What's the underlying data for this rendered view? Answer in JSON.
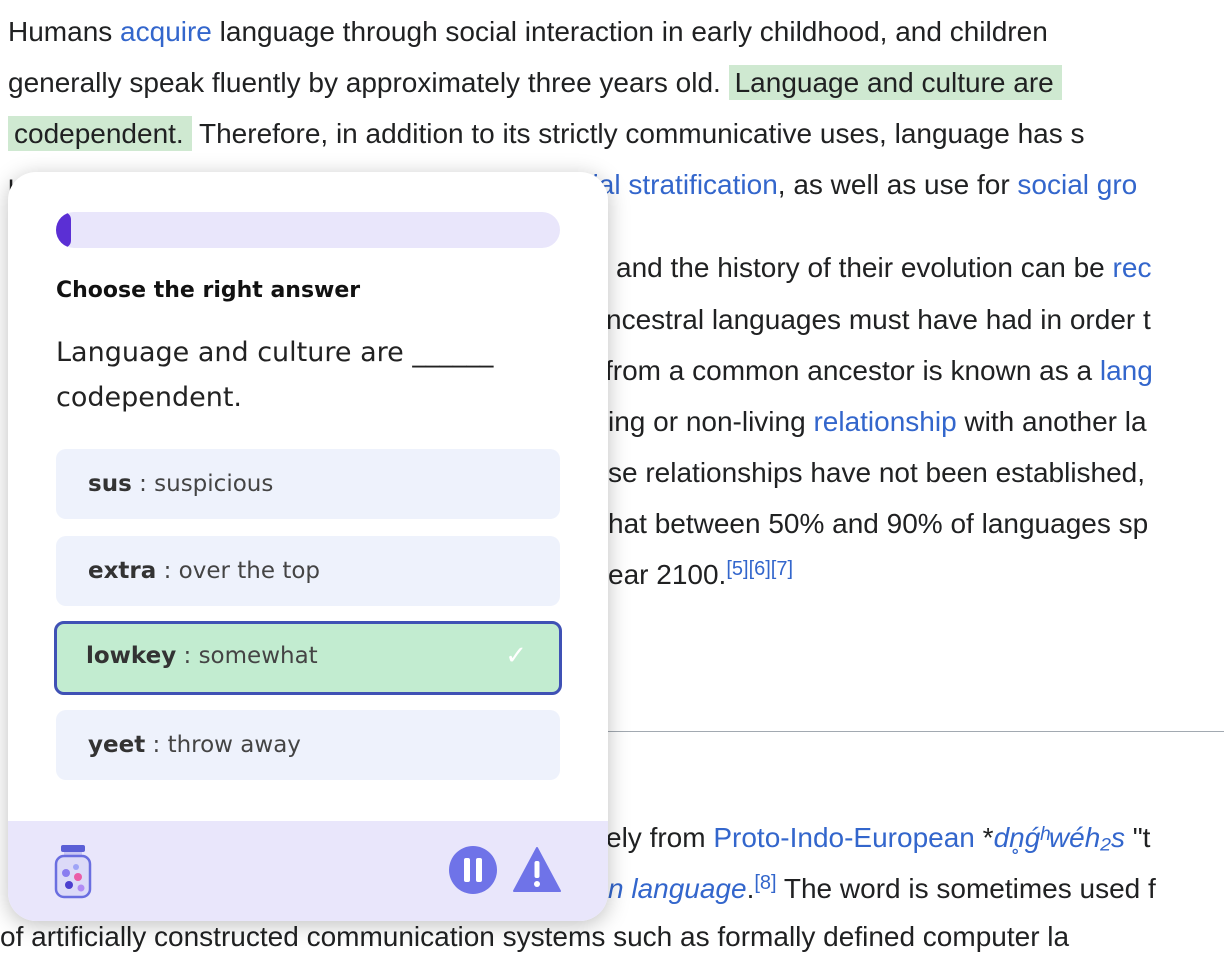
{
  "article": {
    "l1": {
      "a": "Humans ",
      "link": "acquire",
      "b": " language through social interaction in early childhood, and children"
    },
    "l2": {
      "a": "generally speak fluently by approximately three years old. ",
      "hl": "Language and culture are"
    },
    "l3": {
      "hl": "codependent.",
      "b": " Therefore, in addition to its strictly communicative uses, language has s"
    },
    "l4": {
      "a": "u",
      "link1": "cial stratification",
      "b": ", as well as use for ",
      "link2": "social gro"
    },
    "l5": {
      "a": "and the history of their evolution can be ",
      "link": "rec"
    },
    "l6": {
      "a": "ncestral languages must have had in order t"
    },
    "l7": {
      "a": "from a common ancestor is known as a ",
      "link": "lang"
    },
    "l8": {
      "a": "ing or non-living ",
      "link": "relationship",
      "b": " with another la"
    },
    "l9": {
      "a": "se relationships have not been established,"
    },
    "l10": {
      "a": "hat between 50% and 90% of languages sp"
    },
    "l11": {
      "a": "ear 2100.",
      "sup": "[5][6][7]"
    },
    "l12": {
      "a": "ely from ",
      "link": "Proto-Indo-European",
      "b": " *",
      "ital": "dn̥ǵʰwéh₂s",
      "c": " \"t"
    },
    "l13": {
      "link": "n language",
      "b": ".",
      "sup": "[8]",
      "c": " The word is sometimes used f"
    },
    "l14": {
      "a": "of artificially constructed communication systems such as formally defined computer la"
    }
  },
  "quiz": {
    "progress": 0.03,
    "instruction": "Choose the right answer",
    "question": "Language and culture are ______ codependent.",
    "options": [
      {
        "term": "sus",
        "sep": " : ",
        "meaning": "suspicious"
      },
      {
        "term": "extra",
        "sep": " : ",
        "meaning": "over the top"
      },
      {
        "term": "lowkey",
        "sep": " : ",
        "meaning": "somewhat"
      },
      {
        "term": "yeet",
        "sep": " : ",
        "meaning": "throw away"
      }
    ],
    "selected_index": 2,
    "check_icon": "✓",
    "footer_icons": [
      "jar-icon",
      "pause-icon",
      "warning-icon"
    ]
  },
  "colors": {
    "accent": "#5b2fd4",
    "link": "#3366cc",
    "highlight": "#cfe9d1",
    "selected": "#c2ecd0"
  }
}
